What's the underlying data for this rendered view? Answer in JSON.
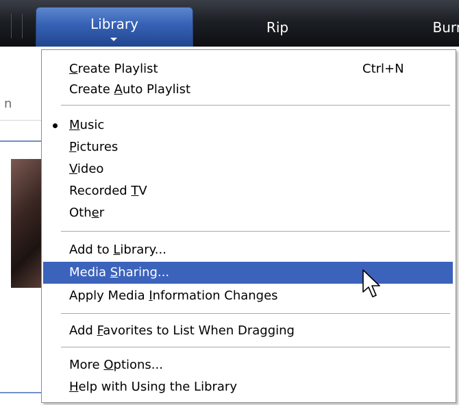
{
  "tabs": [
    {
      "label": "Library"
    },
    {
      "label": "Rip"
    },
    {
      "label": "Burn"
    }
  ],
  "background": {
    "search_fragment": "n"
  },
  "menu": {
    "create_playlist": {
      "pre": "",
      "ul": "C",
      "post": "reate Playlist",
      "shortcut": "Ctrl+N"
    },
    "create_auto_playlist": {
      "pre": "Create ",
      "ul": "A",
      "post": "uto Playlist"
    },
    "music": {
      "pre": "",
      "ul": "M",
      "post": "usic",
      "selected": true
    },
    "pictures": {
      "pre": "",
      "ul": "P",
      "post": "ictures"
    },
    "video": {
      "pre": "",
      "ul": "V",
      "post": "ideo"
    },
    "recorded_tv": {
      "pre": "Recorded ",
      "ul": "T",
      "post": "V"
    },
    "other": {
      "pre": "Oth",
      "ul": "e",
      "post": "r"
    },
    "add_to_library": {
      "pre": "Add to ",
      "ul": "L",
      "post": "ibrary..."
    },
    "media_sharing": {
      "pre": "Media ",
      "ul": "S",
      "post": "haring..."
    },
    "apply_media_info": {
      "pre": "Apply Media ",
      "ul": "I",
      "post": "nformation Changes"
    },
    "add_favorites": {
      "pre": "Add ",
      "ul": "F",
      "post": "avorites to List When Dragging"
    },
    "more_options": {
      "pre": "More ",
      "ul": "O",
      "post": "ptions..."
    },
    "help_library": {
      "pre": "",
      "ul": "H",
      "post": "elp with Using the Library"
    }
  },
  "icons": {
    "bullet": "bullet-dot",
    "cursor": "arrow-cursor",
    "tab_arrow": "chevron-down"
  },
  "colors": {
    "highlight": "#3c63bc",
    "tab_active": "#3561b4"
  }
}
